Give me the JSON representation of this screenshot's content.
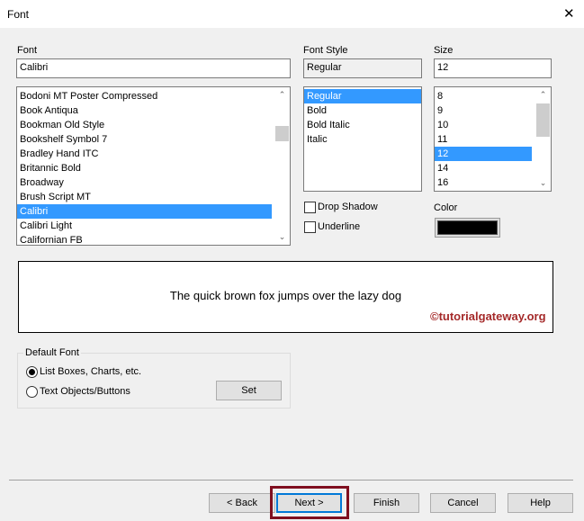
{
  "window": {
    "title": "Font",
    "close": "✕"
  },
  "font": {
    "label": "Font",
    "value": "Calibri",
    "items": [
      "Bodoni MT Poster Compressed",
      "Book Antiqua",
      "Bookman Old Style",
      "Bookshelf Symbol 7",
      "Bradley Hand ITC",
      "Britannic Bold",
      "Broadway",
      "Brush Script MT",
      "Calibri",
      "Calibri Light",
      "Californian FB"
    ],
    "selected_index": 8
  },
  "style": {
    "label": "Font Style",
    "value": "Regular",
    "items": [
      "Regular",
      "Bold",
      "Bold Italic",
      "Italic"
    ],
    "selected_index": 0
  },
  "size": {
    "label": "Size",
    "value": "12",
    "items": [
      "8",
      "9",
      "10",
      "11",
      "12",
      "14",
      "16"
    ],
    "selected_index": 4
  },
  "effects": {
    "drop_shadow": "Drop Shadow",
    "underline": "Underline",
    "drop_shadow_checked": false,
    "underline_checked": false
  },
  "color": {
    "label": "Color",
    "value": "#000000"
  },
  "preview": {
    "text": "The quick brown fox jumps over the lazy dog",
    "watermark": "©tutorialgateway.org"
  },
  "default_font": {
    "label": "Default Font",
    "option1": "List Boxes, Charts, etc.",
    "option2": "Text Objects/Buttons",
    "selected": 1,
    "set": "Set"
  },
  "buttons": {
    "back": "< Back",
    "next": "Next >",
    "finish": "Finish",
    "cancel": "Cancel",
    "help": "Help"
  }
}
